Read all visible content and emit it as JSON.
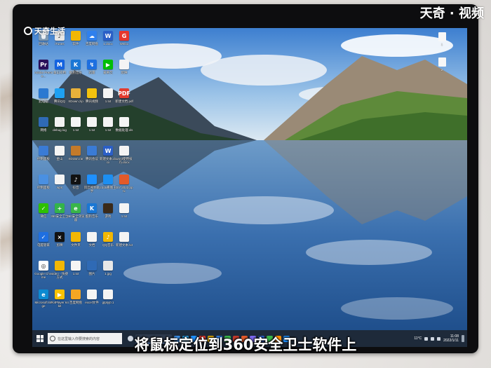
{
  "watermark": {
    "left_text": "天奇生活",
    "right_text": "天奇 · 视频"
  },
  "caption": "将鼠标定位到360安全卫士软件上",
  "desktop": {
    "columns": [
      [
        {
          "name": "回收站",
          "color": "#7f9ab3",
          "glyph": "🗑"
        },
        {
          "name": "Adobe Premie...",
          "color": "#2a0f5a",
          "glyph": "Pr"
        },
        {
          "name": "此电脑",
          "color": "#2b79d1",
          "glyph": ""
        },
        {
          "name": "网络",
          "color": "#2f6ab5",
          "glyph": ""
        },
        {
          "name": "控制面板",
          "color": "#3a7bd5",
          "glyph": ""
        },
        {
          "name": "控制面板",
          "color": "#4a90e2",
          "glyph": ""
        },
        {
          "name": "微信",
          "color": "#2dc100",
          "glyph": "✓"
        },
        {
          "name": "电脑管家",
          "color": "#1f6fe0",
          "glyph": "✓"
        },
        {
          "name": "Google Chrome",
          "color": "#ffffff",
          "glyph": "◎"
        },
        {
          "name": "Microsoft Edge",
          "color": "#0c8ad1",
          "glyph": "e"
        }
      ],
      [
        {
          "name": "iTunes",
          "color": "#e6e6e6",
          "glyph": "♪"
        },
        {
          "name": "金山文档",
          "color": "#1463e0",
          "glyph": "M"
        },
        {
          "name": "腾讯QQ",
          "color": "#1ea0f2",
          "glyph": ""
        },
        {
          "name": "debug.log",
          "color": "#f2f2f2",
          "glyph": ""
        },
        {
          "name": "金山",
          "color": "#f4f4f4",
          "glyph": ""
        },
        {
          "name": "wps",
          "color": "#f4f4f4",
          "glyph": ""
        },
        {
          "name": "360安全卫士",
          "color": "#33b44a",
          "glyph": "+"
        },
        {
          "name": "剪映",
          "color": "#111111",
          "glyph": "⨯"
        },
        {
          "name": "video - 快捷方式",
          "color": "#f2b705",
          "glyph": ""
        },
        {
          "name": "PotPlayer 64 bit",
          "color": "#f8c200",
          "glyph": "▶"
        }
      ],
      [
        {
          "name": "软件",
          "color": "#f2b705",
          "glyph": ""
        },
        {
          "name": "酷狗音乐",
          "color": "#1a77d4",
          "glyph": "K"
        },
        {
          "name": "XDown.zip",
          "color": "#e7b13a",
          "glyph": ""
        },
        {
          "name": "1.txt",
          "color": "#f4f4f4",
          "glyph": ""
        },
        {
          "name": "XDown.rar",
          "color": "#c47a2a",
          "glyph": ""
        },
        {
          "name": "抖音",
          "color": "#111111",
          "glyph": "♪"
        },
        {
          "name": "360安全浏览器",
          "color": "#39b54a",
          "glyph": "e"
        },
        {
          "name": "文件夹",
          "color": "#f2b705",
          "glyph": ""
        },
        {
          "name": "1.txt",
          "color": "#f4f4f4",
          "glyph": ""
        },
        {
          "name": "百度网盘",
          "color": "#f5a623",
          "glyph": ""
        }
      ],
      [
        {
          "name": "百度网盘",
          "color": "#2f80ed",
          "glyph": "☁"
        },
        {
          "name": "迅雷",
          "color": "#1d6fe0",
          "glyph": "↯"
        },
        {
          "name": "腾讯视频",
          "color": "#f4c20d",
          "glyph": ""
        },
        {
          "name": "1.txt",
          "color": "#f4f4f4",
          "glyph": ""
        },
        {
          "name": "腾讯会议",
          "color": "#3a7bd5",
          "glyph": ""
        },
        {
          "name": "风云视频助手",
          "color": "#1e90ff",
          "glyph": ""
        },
        {
          "name": "酷狗音乐",
          "color": "#1a77d4",
          "glyph": "K"
        },
        {
          "name": "文档",
          "color": "#f4f4f4",
          "glyph": ""
        },
        {
          "name": "图片",
          "color": "#2f6ab5",
          "glyph": ""
        },
        {
          "name": "excel文件",
          "color": "#f4f4f4",
          "glyph": ""
        }
      ],
      [
        {
          "name": "1.docx",
          "color": "#2b5fc7",
          "glyph": "W"
        },
        {
          "name": "爱奇艺",
          "color": "#00be06",
          "glyph": "▶"
        },
        {
          "name": "1.txt",
          "color": "#f4f4f4",
          "glyph": ""
        },
        {
          "name": "1.txt",
          "color": "#f4f4f4",
          "glyph": ""
        },
        {
          "name": "新建文本.docx",
          "color": "#2b5fc7",
          "glyph": "W"
        },
        {
          "name": "2345看图王",
          "color": "#1c8ff2",
          "glyph": ""
        },
        {
          "name": "游戏",
          "color": "#3a2a1a",
          "glyph": ""
        },
        {
          "name": "QQ音乐",
          "color": "#f2b705",
          "glyph": "♪"
        },
        {
          "name": "1.jpg",
          "color": "#e8e8e8",
          "glyph": ""
        },
        {
          "name": "gtplyj0.1",
          "color": "#f4f4f4",
          "glyph": ""
        }
      ],
      [
        {
          "name": "Weibo",
          "color": "#e6372e",
          "glyph": "G"
        },
        {
          "name": "剪映",
          "color": "#f4f4f4",
          "glyph": ""
        },
        {
          "name": "新建文档.pdf",
          "color": "#e33b2e",
          "glyph": "PDF"
        },
        {
          "name": "数据处理.xls",
          "color": "#f4f4f4",
          "glyph": ""
        },
        {
          "name": "word使用技巧.docx",
          "color": "#f4f4f4",
          "glyph": ""
        },
        {
          "name": "007 2022.pptx",
          "color": "#e25a2a",
          "glyph": ""
        },
        {
          "name": "1.txt",
          "color": "#f4f4f4",
          "glyph": ""
        },
        {
          "name": "新建文本.txt",
          "color": "#f4f4f4",
          "glyph": ""
        },
        {
          "name": "",
          "color": "",
          "glyph": ""
        },
        {
          "name": "",
          "color": "",
          "glyph": ""
        }
      ]
    ],
    "right_icons": [
      {
        "name": "1"
      },
      {
        "name": "2"
      }
    ]
  },
  "taskbar": {
    "search_placeholder": "在这里输入你要搜索的内容",
    "weather": "11°C",
    "time": "11:08",
    "date": "2022/1/11",
    "app_colors": [
      "#3a8ee6",
      "#29a0e8",
      "#1e90ff",
      "#e6372e",
      "#f2b705",
      "#2f80ed",
      "#39b54a",
      "#c0392b",
      "#e25a2a",
      "#7b68ee",
      "#2b5fc7",
      "#39b54a",
      "#ff8c00",
      "#1e90ff"
    ]
  }
}
